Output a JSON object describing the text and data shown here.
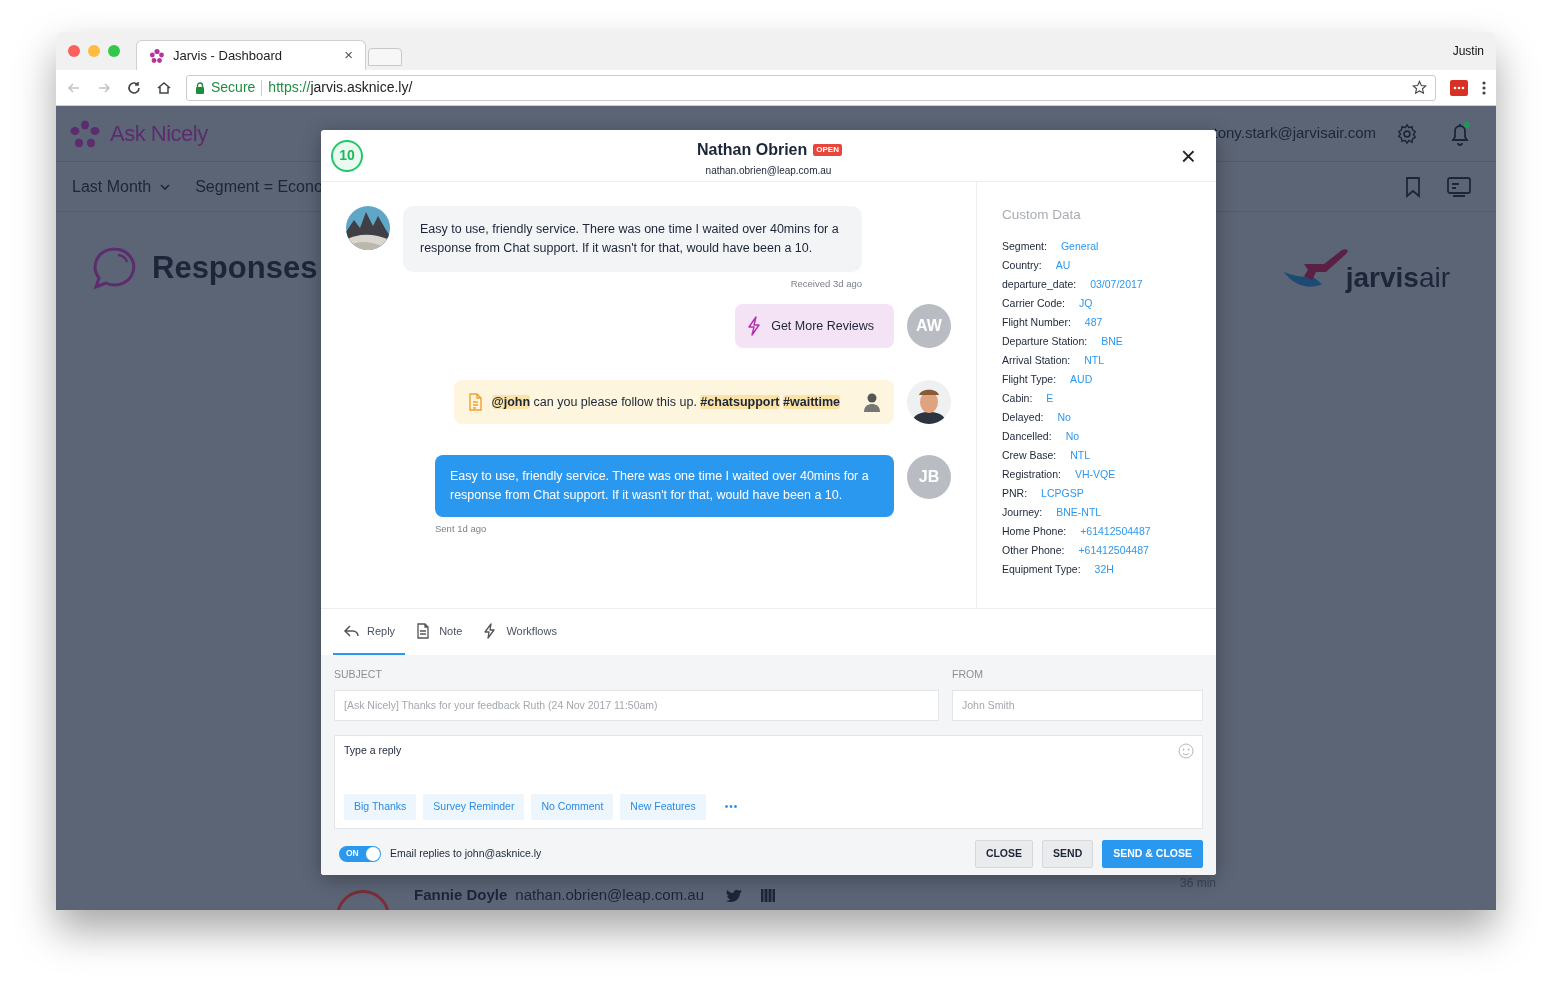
{
  "browser": {
    "tab_title": "Jarvis - Dashboard",
    "tab_close": "×",
    "profile": "Justin",
    "secure": "Secure",
    "url": "https://jarvis.asknice.ly/"
  },
  "app": {
    "logo": "Ask Nicely",
    "user": "tony.stark@jarvisair.com",
    "filters": [
      "Last Month",
      "Segment = Econo"
    ],
    "page_title": "Responses",
    "brand_logo": "**jarvis**air",
    "behind_row": {
      "name": "Fannie Doyle",
      "email": "nathan.obrien@leap.com.au",
      "time": "36 min"
    }
  },
  "modal": {
    "score": "10",
    "name": "Nathan Obrien",
    "status": "OPEN",
    "email": "nathan.obrien@leap.com.au",
    "close": "×",
    "messages": [
      {
        "kind": "response",
        "text": "Easy to use, friendly service. There was one time I waited over 40mins for a response from Chat support. If it wasn't for that, would have been a 10.",
        "meta": "Received 3d ago"
      },
      {
        "kind": "workflow",
        "text": "Get More Reviews",
        "initials": "AW"
      },
      {
        "kind": "note",
        "text": "**@john** can you please follow this up. **#chatsupport** **#waittime**"
      },
      {
        "kind": "sent",
        "text": "Easy to use, friendly service. There was one time I waited over 40mins for a response from Chat support. If it wasn't for that, would have been a 10.",
        "initials": "JB",
        "meta": "Sent 1d ago"
      }
    ],
    "custom_data": {
      "title": "Custom Data",
      "rows": [
        {
          "label": "Segment:",
          "value": "General"
        },
        {
          "label": "Country:",
          "value": "AU"
        },
        {
          "label": "departure_date:",
          "value": "03/07/2017"
        },
        {
          "label": "Carrier Code:",
          "value": "JQ"
        },
        {
          "label": "Flight Number:",
          "value": "487"
        },
        {
          "label": "Departure Station:",
          "value": "BNE"
        },
        {
          "label": "Arrival Station:",
          "value": "NTL"
        },
        {
          "label": "Flight Type:",
          "value": "AUD"
        },
        {
          "label": "Cabin:",
          "value": "E"
        },
        {
          "label": "Delayed:",
          "value": "No"
        },
        {
          "label": "Dancelled:",
          "value": "No"
        },
        {
          "label": "Crew Base:",
          "value": "NTL"
        },
        {
          "label": "Registration:",
          "value": "VH-VQE"
        },
        {
          "label": "PNR:",
          "value": "LCPGSP"
        },
        {
          "label": "Journey:",
          "value": "BNE-NTL"
        },
        {
          "label": "Home Phone:",
          "value": "+61412504487"
        },
        {
          "label": "Other Phone:",
          "value": "+61412504487"
        },
        {
          "label": "Equipment Type:",
          "value": "32H"
        }
      ]
    },
    "tabs": [
      {
        "kind": "reply",
        "label": "Reply",
        "selected": true
      },
      {
        "kind": "note",
        "label": "Note",
        "selected": false
      },
      {
        "kind": "workflows",
        "label": "Workflows",
        "selected": false
      }
    ],
    "subject": {
      "label": "SUBJECT",
      "placeholder": "[Ask Nicely] Thanks for your feedback Ruth (24 Nov 2017 11:50am)"
    },
    "from": {
      "label": "FROM",
      "placeholder": "John Smith"
    },
    "reply": {
      "placeholder": "Type a reply"
    },
    "quick_replies": [
      "Big Thanks",
      "Survey Reminder",
      "No Comment",
      "New Features"
    ],
    "more": "•••",
    "email_toggle": {
      "on": true,
      "label": "ON",
      "text": "Email replies to john@asknice.ly"
    },
    "buttons": [
      {
        "kind": "secondary",
        "label": "CLOSE"
      },
      {
        "kind": "secondary",
        "label": "SEND"
      },
      {
        "kind": "primary",
        "label": "SEND & CLOSE"
      }
    ]
  }
}
